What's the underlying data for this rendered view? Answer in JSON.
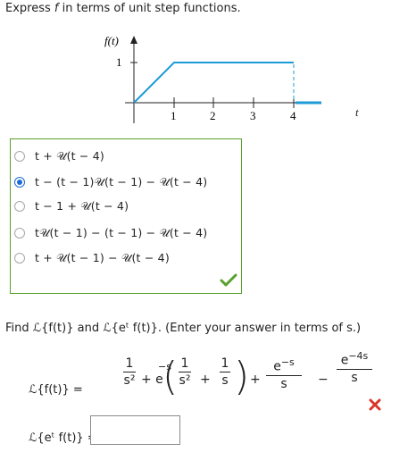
{
  "question": {
    "prefix": "Express ",
    "var": "f",
    "suffix": " in terms of unit step functions."
  },
  "graph": {
    "y_label": "f(t)",
    "y_tick": "1",
    "x_ticks": [
      "1",
      "2",
      "3",
      "4"
    ],
    "x_label": "t",
    "line_color": "#1e9bd7"
  },
  "options": [
    {
      "label": "t + 𝒰(t − 4)",
      "selected": false
    },
    {
      "label": "t − (t − 1)𝒰(t − 1) − 𝒰(t − 4)",
      "selected": true
    },
    {
      "label": "t − 1 + 𝒰(t − 4)",
      "selected": false
    },
    {
      "label": "t𝒰(t − 1) − (t − 1) − 𝒰(t − 4)",
      "selected": false
    },
    {
      "label": "t + 𝒰(t − 1) − 𝒰(t − 4)",
      "selected": false
    }
  ],
  "status": {
    "correct_color": "#5aa02c",
    "incorrect_color": "#d9362b"
  },
  "find_text": "Find ℒ{f(t)} and ℒ{eᵗ f(t)}. (Enter your answer in terms of s.)",
  "answer1": {
    "lhs": "ℒ{f(t)}  =",
    "one_a": "1",
    "s2_a": "s²",
    "plus_e": "+ e",
    "neg_s": "−s",
    "one_b": "1",
    "s2_b": "s²",
    "plus": "+",
    "one_c": "1",
    "s_c": "s",
    "plus2": "+",
    "e_num1": "e",
    "exp1": "−s",
    "s_d": "s",
    "minus": "−",
    "e_num2": "e",
    "exp2": "−4s",
    "s_e": "s"
  },
  "answer2": {
    "lhs": "ℒ{eᵗ f(t)}  =",
    "value": ""
  }
}
